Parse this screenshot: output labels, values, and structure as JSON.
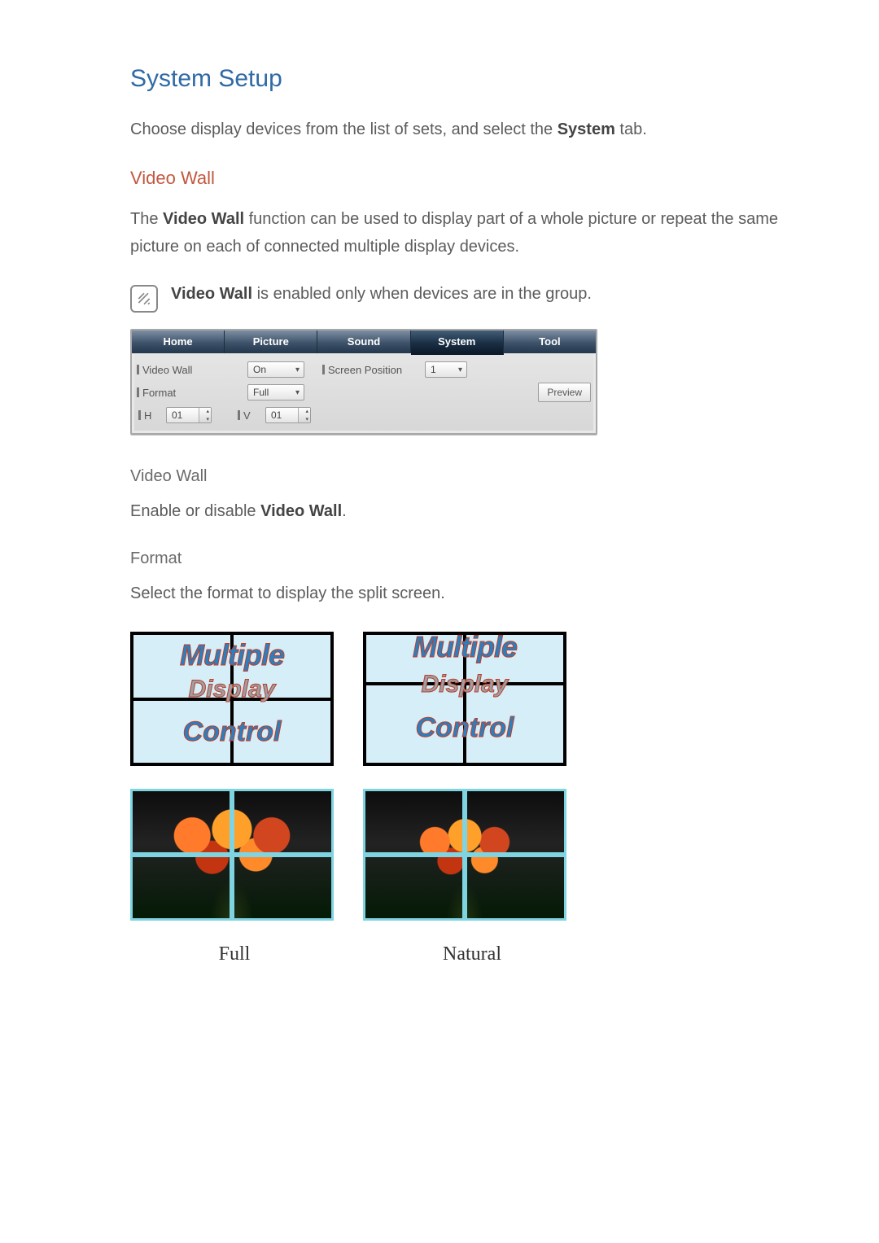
{
  "headings": {
    "main": "System Setup",
    "sub": "Video Wall"
  },
  "intro": {
    "prefix": "Choose display devices from the list of sets, and select the ",
    "bold": "System",
    "suffix": " tab."
  },
  "desc": {
    "prefix": "The ",
    "bold": "Video Wall",
    "suffix": " function can be used to display part of a whole picture or repeat the same picture on each of connected multiple display devices."
  },
  "note": {
    "bold": "Video Wall",
    "suffix": " is enabled only when devices are in the group."
  },
  "panel": {
    "tabs": [
      "Home",
      "Picture",
      "Sound",
      "System",
      "Tool"
    ],
    "active_tab": 3,
    "videoWall": {
      "label": "Video Wall",
      "value": "On"
    },
    "format": {
      "label": "Format",
      "value": "Full"
    },
    "screenPos": {
      "label": "Screen Position",
      "value": "1"
    },
    "preview": "Preview",
    "h": {
      "label": "H",
      "value": "01"
    },
    "v": {
      "label": "V",
      "value": "01"
    }
  },
  "sections": {
    "video_wall_label": "Video Wall",
    "video_wall_text_prefix": "Enable or disable ",
    "video_wall_text_bold": "Video Wall",
    "video_wall_text_suffix": ".",
    "format_label": "Format",
    "format_text": "Select the format to display the split screen."
  },
  "mdc": {
    "line1": "Multiple",
    "line2": "Display",
    "line3": "Control"
  },
  "captions": {
    "full": "Full",
    "natural": "Natural"
  }
}
